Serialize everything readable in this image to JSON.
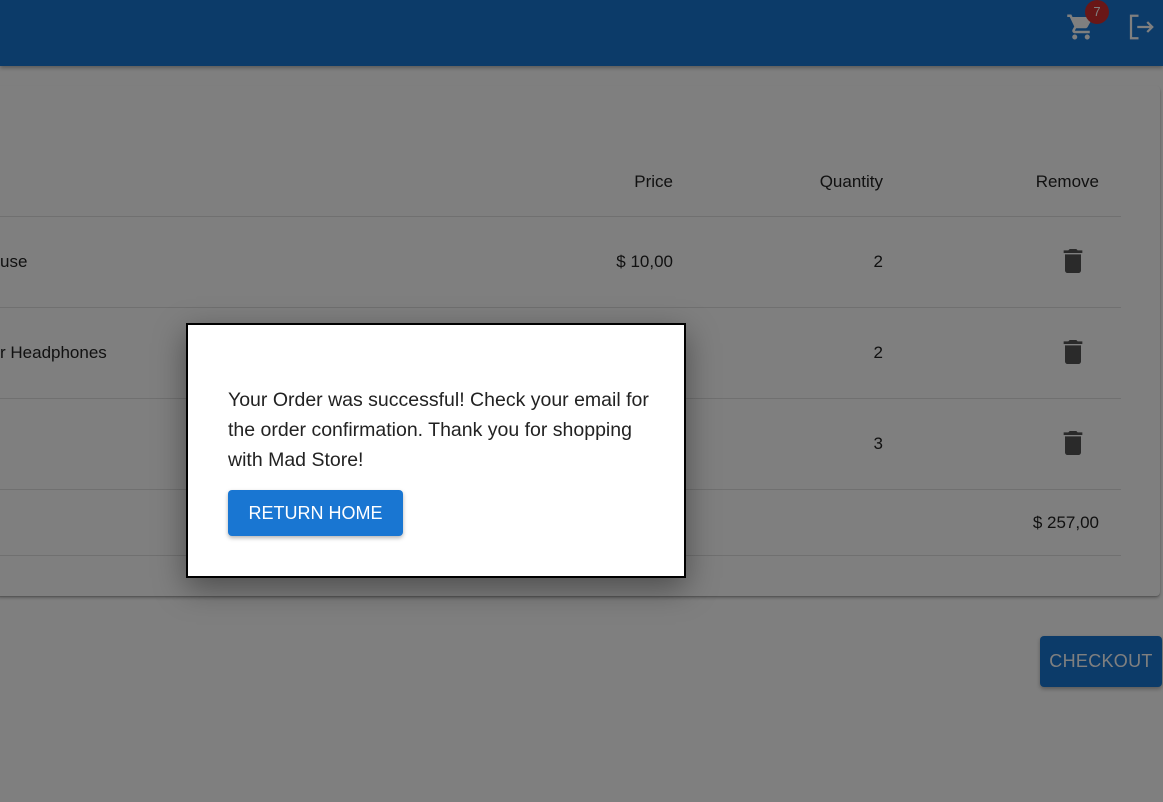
{
  "colors": {
    "primary": "#1976d2",
    "badge": "#d32f2f",
    "overlay": "rgba(0,0,0,0.5)"
  },
  "header": {
    "cart_icon": "shopping-cart-icon",
    "cart_count": "7",
    "logout_icon": "logout-icon"
  },
  "cart": {
    "columns": {
      "price": "Price",
      "quantity": "Quantity",
      "remove": "Remove"
    },
    "items": [
      {
        "name": "use",
        "price": "$ 10,00",
        "quantity": "2"
      },
      {
        "name": "r Headphones",
        "price": "",
        "quantity": "2"
      },
      {
        "name": "",
        "price": "",
        "quantity": "3"
      }
    ],
    "remove_icon": "trash-icon",
    "total": "$ 257,00",
    "checkout_label": "CHECKOUT"
  },
  "dialog": {
    "message": "Your Order was successful! Check your email for the order confirmation. Thank you for shopping with Mad Store!",
    "return_label": "RETURN HOME"
  }
}
